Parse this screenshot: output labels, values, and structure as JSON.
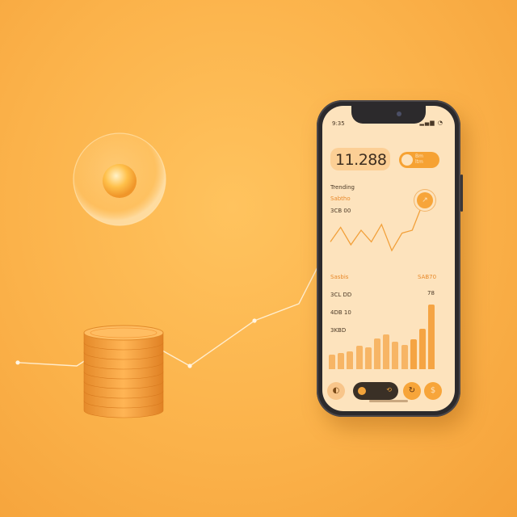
{
  "phone": {
    "status_time": "9:35",
    "status_icons": "▂▄▆ ◔",
    "balance": "11.288",
    "toggle_text_1": "Bm",
    "toggle_text_2": "ltm",
    "trending_label": "Trending",
    "chart_label_1": "Sabtho",
    "chart_label_2": "3CB 00",
    "chart_badge_icon": "trend-up-icon",
    "chart_badge_glyph": "↗",
    "section_left": "Sasbis",
    "section_right": "SAB70",
    "section_right_small": "78",
    "axis_1": "3CL DD",
    "axis_2": "4DB 10",
    "axis_3": "3KBD",
    "bar_values": [
      0.22,
      0.25,
      0.28,
      0.36,
      0.34,
      0.48,
      0.54,
      0.42,
      0.38,
      0.46,
      0.62,
      1.0
    ],
    "line_values": [
      0.3,
      0.55,
      0.25,
      0.5,
      0.3,
      0.6,
      0.15,
      0.45,
      0.5,
      0.95
    ],
    "nav": {
      "left_glyph": "◐",
      "center_glyph": "⟲",
      "right1_glyph": "↻",
      "right2_glyph": "$"
    }
  },
  "colors": {
    "background": "#fbb24a",
    "accent": "#f6a233",
    "screen": "#fde3bd",
    "phone_frame": "#2c2a2c"
  },
  "floor_line_points": [
    0.08,
    0.05,
    0.35,
    0.05,
    0.45,
    0.6,
    0.95
  ],
  "coin_stack_count": 8
}
